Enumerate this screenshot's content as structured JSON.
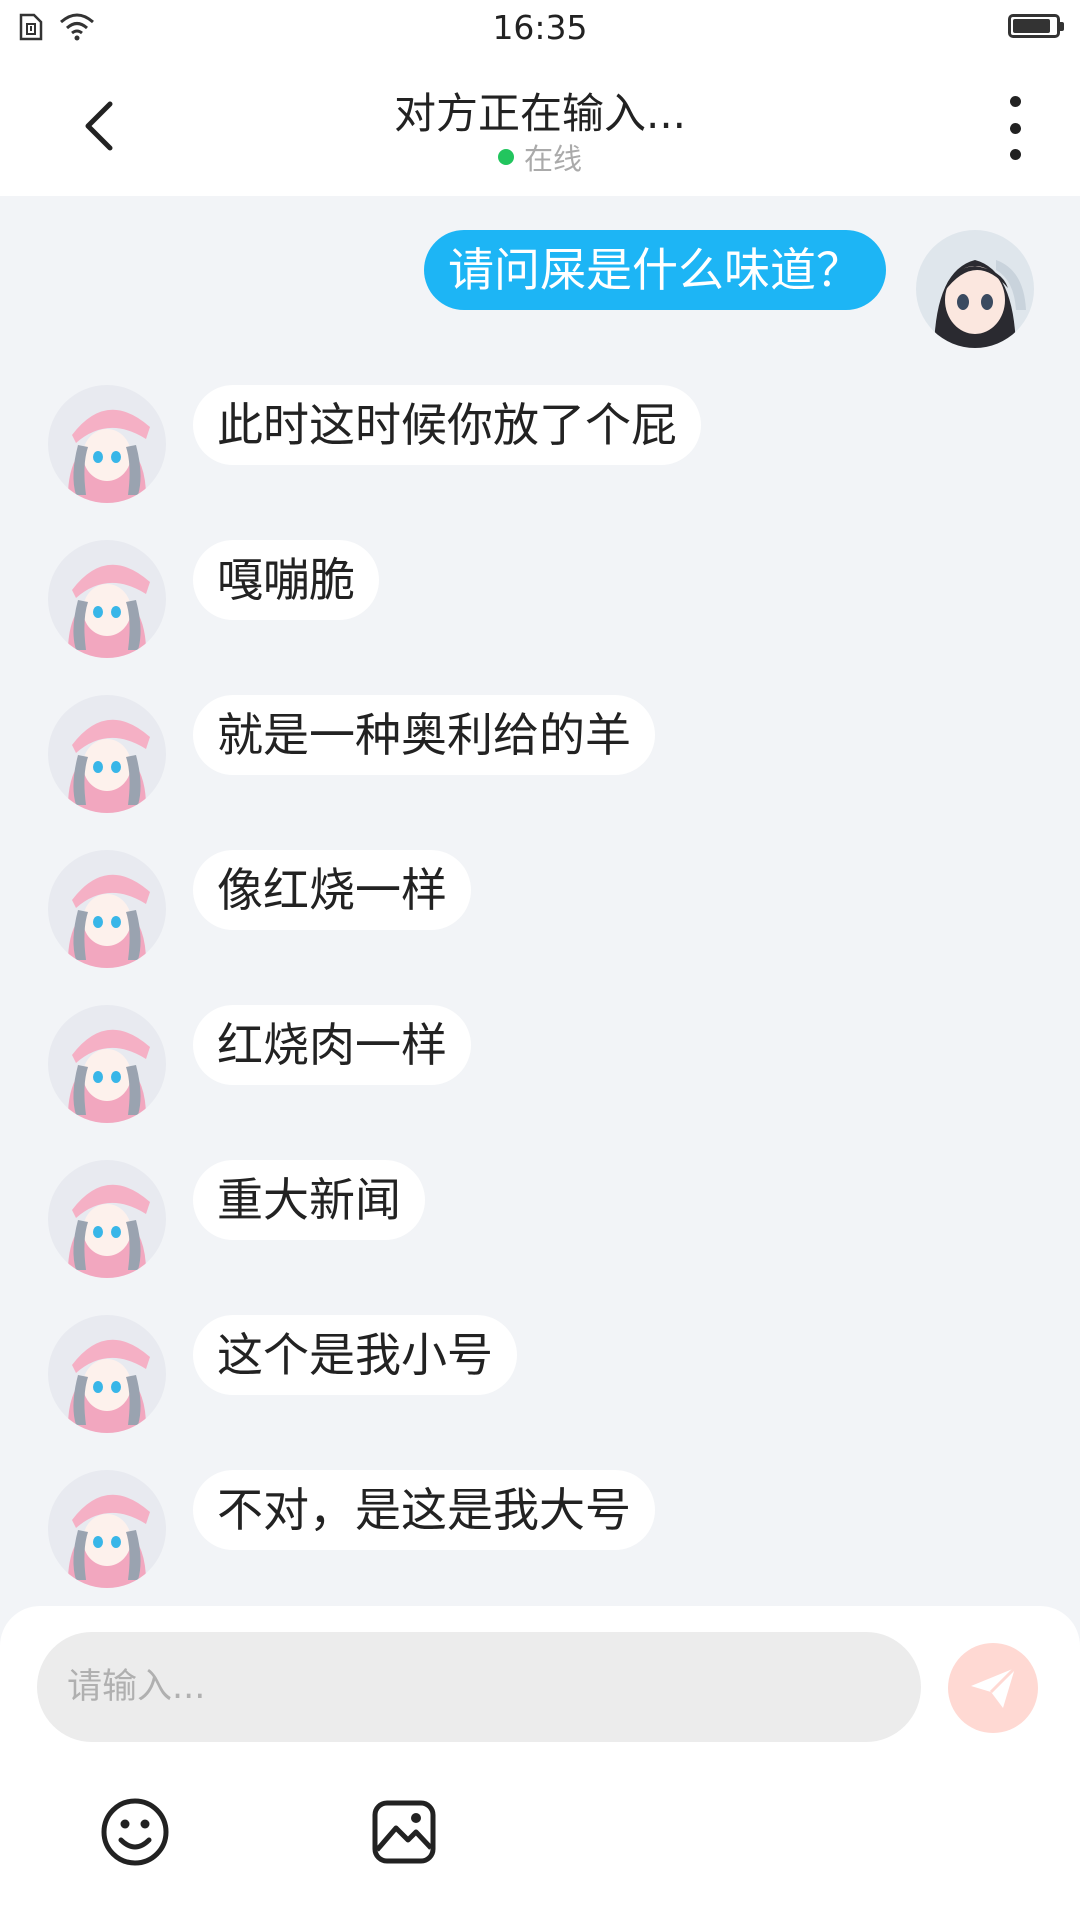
{
  "status_bar": {
    "time": "16:35",
    "icons": [
      "sim-card-icon",
      "wifi-icon",
      "battery-icon"
    ],
    "battery_level": 0.85
  },
  "header": {
    "title": "对方正在输入...",
    "presence_status": "在线",
    "presence_color": "#22c55e"
  },
  "messages": [
    {
      "side": "out",
      "text": "请问屎是什么味道？"
    },
    {
      "side": "in",
      "text": "此时这时候你放了个屁"
    },
    {
      "side": "in",
      "text": "嘎嘣脆"
    },
    {
      "side": "in",
      "text": "就是一种奥利给的羊"
    },
    {
      "side": "in",
      "text": "像红烧一样"
    },
    {
      "side": "in",
      "text": "红烧肉一样"
    },
    {
      "side": "in",
      "text": "重大新闻"
    },
    {
      "side": "in",
      "text": "这个是我小号"
    },
    {
      "side": "in",
      "text": "不对，是这是我大号"
    }
  ],
  "composer": {
    "placeholder": "请输入..."
  },
  "colors": {
    "outgoing_bubble": "#1db5f5",
    "incoming_bubble": "#ffffff",
    "background": "#f2f4f7",
    "send_button": "#ffd9d3"
  }
}
